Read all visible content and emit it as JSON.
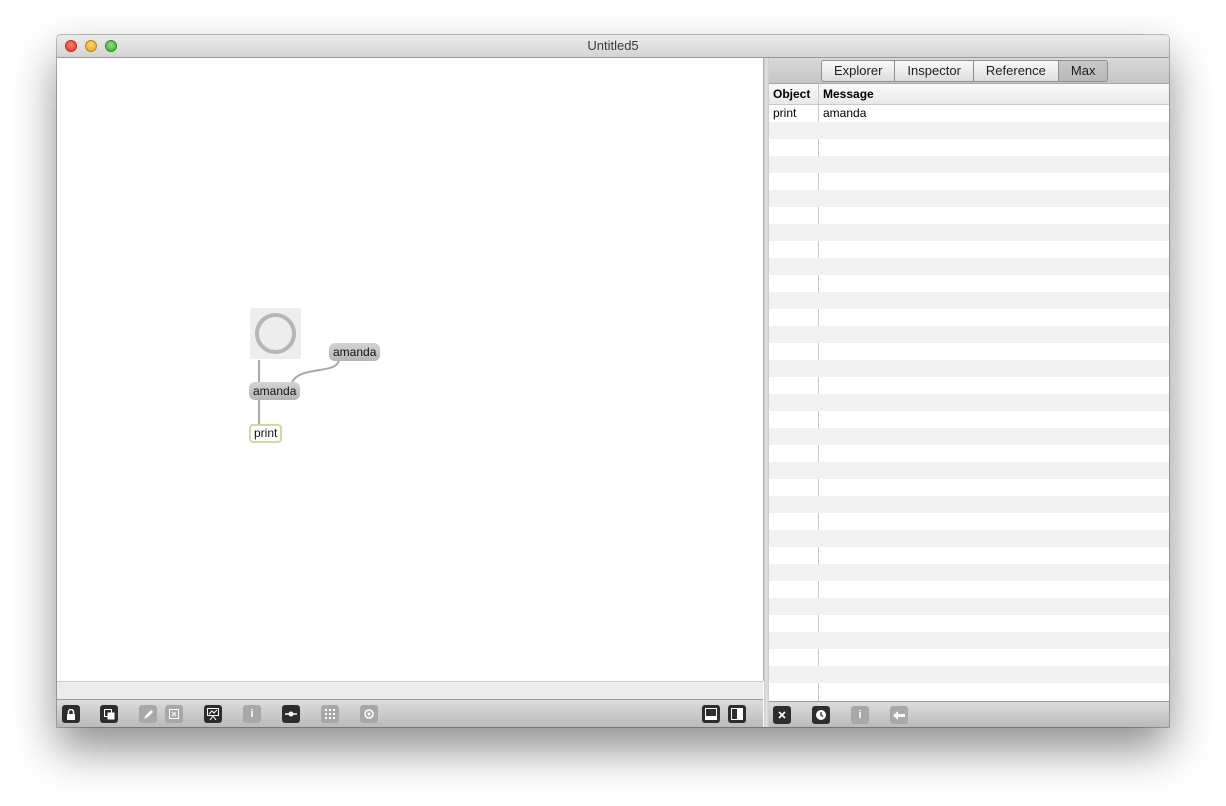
{
  "window": {
    "title": "Untitled5"
  },
  "patch": {
    "message1": "amanda",
    "message2": "amanda",
    "object": "print"
  },
  "sidebar": {
    "tabs": [
      "Explorer",
      "Inspector",
      "Reference",
      "Max"
    ],
    "active_tab": "Max",
    "columns": {
      "object": "Object",
      "message": "Message"
    },
    "rows": [
      {
        "object": "print",
        "message": "amanda"
      }
    ]
  },
  "toolbar": {
    "left_icons": [
      "lock-icon",
      "new-view-icon",
      "edit-icon",
      "delete-icon",
      "presentation-icon",
      "info-icon",
      "connect-icon",
      "grid-icon",
      "snap-icon"
    ],
    "layout_icons": [
      "bottom-panel-icon",
      "side-panel-icon"
    ],
    "sidebar_icons": [
      "clear-icon",
      "clock-icon",
      "info-icon",
      "back-icon"
    ]
  }
}
